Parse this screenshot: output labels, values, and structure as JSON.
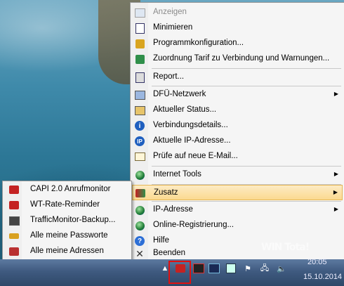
{
  "main_menu": {
    "items": [
      {
        "label": "Anzeigen",
        "icon": "window-icon",
        "disabled": true
      },
      {
        "label": "Minimieren",
        "icon": "document-icon"
      },
      {
        "label": "Programmkonfiguration...",
        "icon": "config-icon"
      },
      {
        "label": "Zuordnung Tarif zu Verbindung und Warnungen...",
        "icon": "calculator-icon"
      },
      {
        "label": "Report...",
        "icon": "report-icon"
      },
      {
        "label": "DFÜ-Netzwerk",
        "icon": "network-icon",
        "submenu": true
      },
      {
        "label": "Aktueller Status...",
        "icon": "status-icon"
      },
      {
        "label": "Verbindungsdetails...",
        "icon": "info-icon"
      },
      {
        "label": "Aktuelle IP-Adresse...",
        "icon": "ip-icon"
      },
      {
        "label": "Prüfe auf neue E-Mail...",
        "icon": "mail-icon"
      },
      {
        "label": "Internet Tools",
        "icon": "globe-icon",
        "submenu": true
      },
      {
        "label": "Zusatz",
        "icon": "addons-icon",
        "submenu": true,
        "highlighted": true
      },
      {
        "label": "IP-Adresse",
        "icon": "ip-globe-icon",
        "submenu": true
      },
      {
        "label": "Online-Registrierung...",
        "icon": "registration-icon"
      },
      {
        "label": "Hilfe",
        "icon": "help-icon"
      },
      {
        "label": "Beenden",
        "icon": "close-icon"
      }
    ]
  },
  "sub_menu": {
    "items": [
      {
        "label": "CAPI 2.0 Anrufmonitor",
        "icon": "phone-icon"
      },
      {
        "label": "WT-Rate-Reminder",
        "icon": "phone-icon"
      },
      {
        "label": "TrafficMonitor-Backup...",
        "icon": "backup-icon"
      },
      {
        "label": "Alle meine Passworte",
        "icon": "key-icon"
      },
      {
        "label": "Alle meine Adressen",
        "icon": "addressbook-icon"
      }
    ]
  },
  "taskbar": {
    "time": "20:05",
    "date": "15.10.2014",
    "watermark": "WIN Tota!"
  },
  "colors": {
    "highlight_border": "#e01010",
    "menu_hover": "#fbd98f"
  }
}
